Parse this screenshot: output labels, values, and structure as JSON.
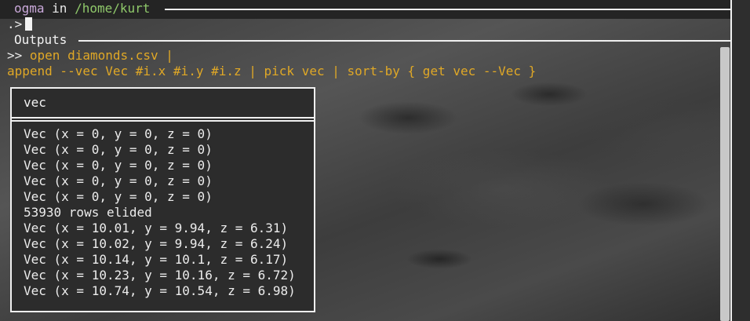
{
  "prompt_header": {
    "user": "ogma",
    "in_word": "in",
    "path": "/home/kurt"
  },
  "input_line": {
    "prompt": ".>",
    "value": ""
  },
  "outputs": {
    "title": "Outputs",
    "command_prompt": ">>",
    "command_line_1": "open diamonds.csv |",
    "command_line_2": "append --vec Vec #i.x #i.y #i.z | pick vec | sort-by { get vec --Vec }",
    "table": {
      "header": "vec",
      "rows": [
        "Vec (x = 0, y = 0, z = 0)",
        "Vec (x = 0, y = 0, z = 0)",
        "Vec (x = 0, y = 0, z = 0)",
        "Vec (x = 0, y = 0, z = 0)",
        "Vec (x = 0, y = 0, z = 0)",
        "53930 rows elided",
        "Vec (x = 10.01, y = 9.94, z = 6.31)",
        "Vec (x = 10.02, y = 9.94, z = 6.24)",
        "Vec (x = 10.14, y = 10.1, z = 6.17)",
        "Vec (x = 10.23, y = 10.16, z = 6.72)",
        "Vec (x = 10.74, y = 10.54, z = 6.98)"
      ]
    }
  },
  "colors": {
    "user": "#c9a8d9",
    "path": "#8fc86a",
    "command": "#e0a826"
  }
}
